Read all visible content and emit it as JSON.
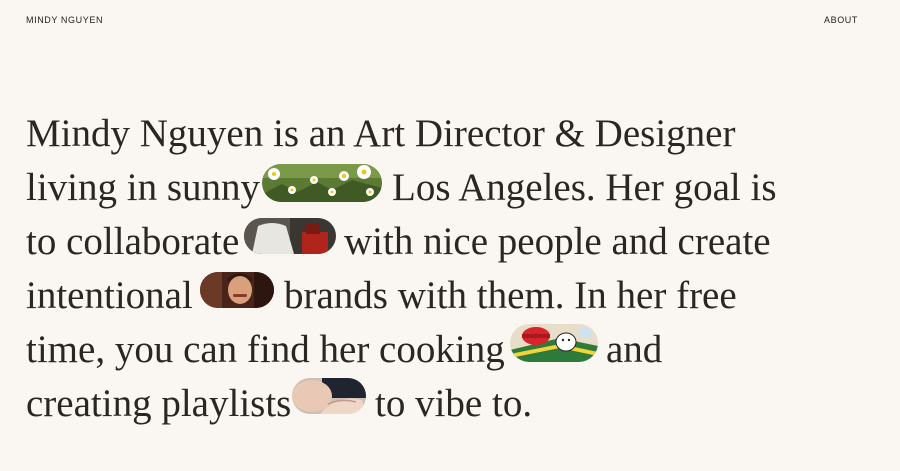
{
  "nav": {
    "brand": "MINDY NGUYEN",
    "about": "ABOUT"
  },
  "bio": {
    "line1": "Mindy Nguyen is an Art Director & Designer",
    "line2a": "living in sunny",
    "line2b": "Los Angeles. Her goal is",
    "line3a": "to collaborate",
    "line3b": "with nice people and create",
    "line4a": "intentional",
    "line4b": "brands with them. In her free",
    "line5a": "time, you can find her cooking",
    "line5b": "and",
    "line6a": "creating playlists",
    "line6b": "to vibe to."
  },
  "colors": {
    "background": "#faf6f1",
    "text": "#2b2622"
  },
  "images": [
    {
      "name": "daisies-image",
      "subject": "white daisy flowers in green grass"
    },
    {
      "name": "collaborate-image",
      "subject": "person in white shirt with red shape"
    },
    {
      "name": "portrait-image",
      "subject": "man smiling"
    },
    {
      "name": "cooking-image",
      "subject": "cartoon character cooking with red pot"
    },
    {
      "name": "playlist-image",
      "subject": "hand holding record"
    }
  ]
}
